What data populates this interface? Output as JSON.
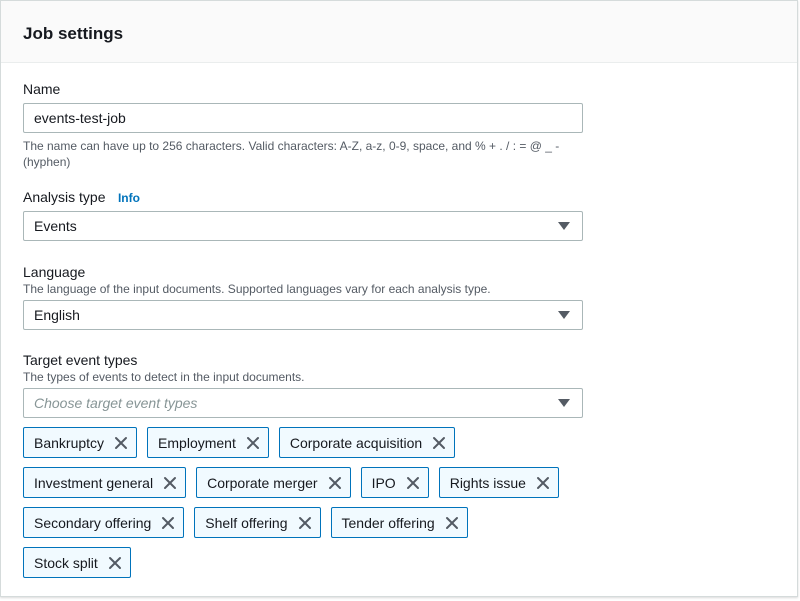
{
  "panel": {
    "title": "Job settings"
  },
  "name_field": {
    "label": "Name",
    "value": "events-test-job",
    "constraint_line1": "The name can have up to 256 characters. Valid characters: A-Z, a-z, 0-9, space, and % + . / : = @ _ -",
    "constraint_line2": "(hyphen)"
  },
  "analysis_type": {
    "label": "Analysis type",
    "info_link": "Info",
    "selected": "Events"
  },
  "language": {
    "label": "Language",
    "description": "The language of the input documents. Supported languages vary for each analysis type.",
    "selected": "English"
  },
  "target_event_types": {
    "label": "Target event types",
    "description": "The types of events to detect in the input documents.",
    "placeholder": "Choose target event types",
    "selected_tokens": [
      [
        "Bankruptcy",
        "Employment",
        "Corporate acquisition"
      ],
      [
        "Investment general",
        "Corporate merger",
        "IPO",
        "Rights issue"
      ],
      [
        "Secondary offering",
        "Shelf offering",
        "Tender offering"
      ],
      [
        "Stock split"
      ]
    ]
  },
  "icons": {
    "dropdown": "caret-down-icon",
    "remove": "close-icon"
  },
  "colors": {
    "token_border": "#0073bb",
    "token_background": "#f1faff",
    "info_link": "#0073bb"
  }
}
